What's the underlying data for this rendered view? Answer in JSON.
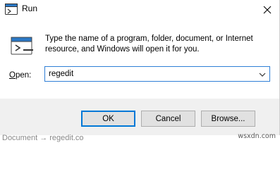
{
  "window": {
    "title": "Run",
    "icon": "run-app-icon",
    "close_icon": "close-icon"
  },
  "content": {
    "description": "Type the name of a program, folder, document, or Internet resource, and Windows will open it for you.",
    "open_label_access": "O",
    "open_label_rest": "pen:",
    "input_value": "regedit"
  },
  "buttons": {
    "ok": "OK",
    "cancel": "Cancel",
    "browse": "Browse..."
  },
  "background": {
    "partial_text": "Document → regedit.co",
    "watermark": "wsxdn.com"
  },
  "colors": {
    "focus_border": "#2f7fd6",
    "default_button_border": "#0078d7",
    "footer_bg": "#f0f0f0"
  }
}
